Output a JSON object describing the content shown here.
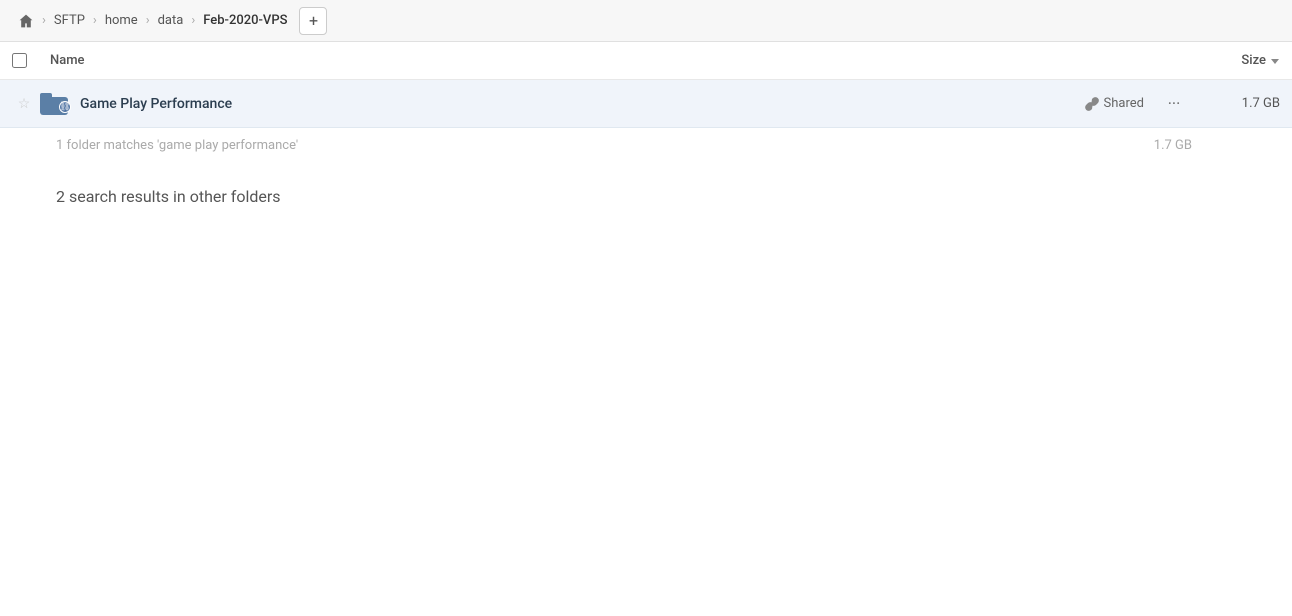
{
  "breadcrumb": {
    "home_label": "home",
    "items": [
      {
        "label": "SFTP",
        "active": false
      },
      {
        "label": "home",
        "active": false
      },
      {
        "label": "data",
        "active": false
      },
      {
        "label": "Feb-2020-VPS",
        "active": true
      }
    ],
    "add_button_label": "+"
  },
  "column_header": {
    "name_label": "Name",
    "size_label": "Size"
  },
  "file_row": {
    "name": "Game Play Performance",
    "shared_label": "Shared",
    "size": "1.7 GB"
  },
  "search_info": {
    "text": "1 folder matches 'game play performance'",
    "size": "1.7 GB"
  },
  "other_folders": {
    "title": "2 search results in other folders"
  }
}
